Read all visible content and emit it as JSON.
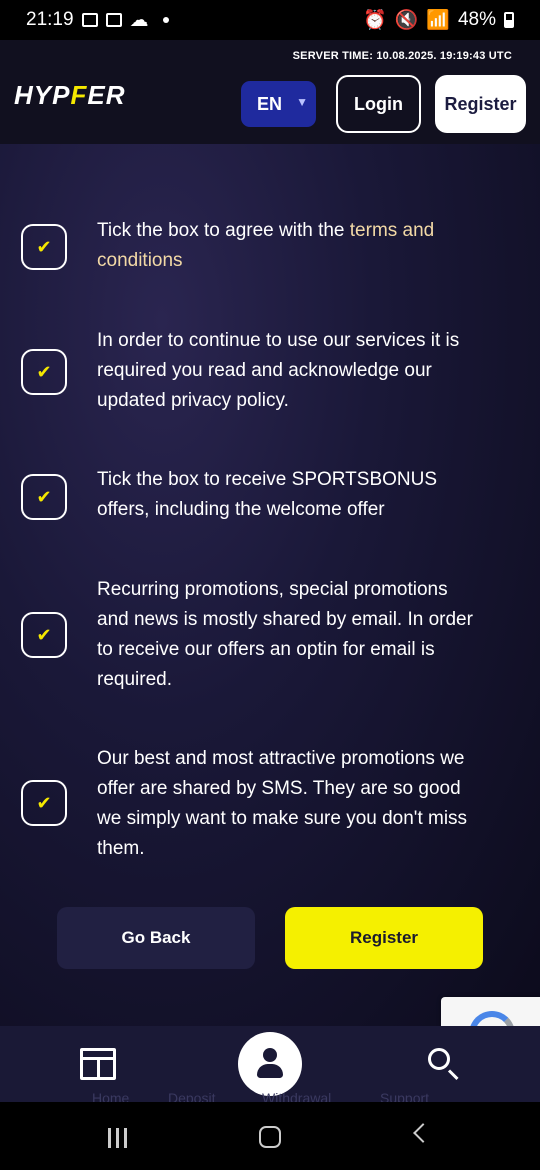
{
  "status_bar": {
    "time": "21:19",
    "battery": "48%"
  },
  "header": {
    "server_time": "SERVER TIME: 10.08.2025. 19:19:43 UTC",
    "logo_main": "HYP",
    "logo_accent": "ER",
    "language": "EN",
    "login_label": "Login",
    "register_label": "Register"
  },
  "consents": [
    {
      "text": "Tick the box to agree with the ",
      "link": "terms and conditions",
      "checked": true
    },
    {
      "text": "In order to continue to use our services it is required you read and acknowledge our updated privacy policy.",
      "checked": true
    },
    {
      "text": "Tick the box to receive SPORTSBONUS offers, including the welcome offer",
      "checked": true
    },
    {
      "text": "Recurring promotions, special promotions and news is mostly shared by email. In order to receive our offers an optin for email is required.",
      "checked": true
    },
    {
      "text": "Our best and most attractive promotions we offer are shared by SMS. They are so good we simply want to make sure you don't miss them.",
      "checked": true
    }
  ],
  "actions": {
    "go_back_label": "Go Back",
    "register_label": "Register"
  },
  "bottom_nav": {
    "items": [
      "Home",
      "Deposit",
      "Withdrawal",
      "Support"
    ]
  },
  "colors": {
    "accent_yellow": "#f5f000",
    "header_bg": "#11101f",
    "lang_blue": "#1f2a9e",
    "link_color": "#f2d9a6"
  }
}
